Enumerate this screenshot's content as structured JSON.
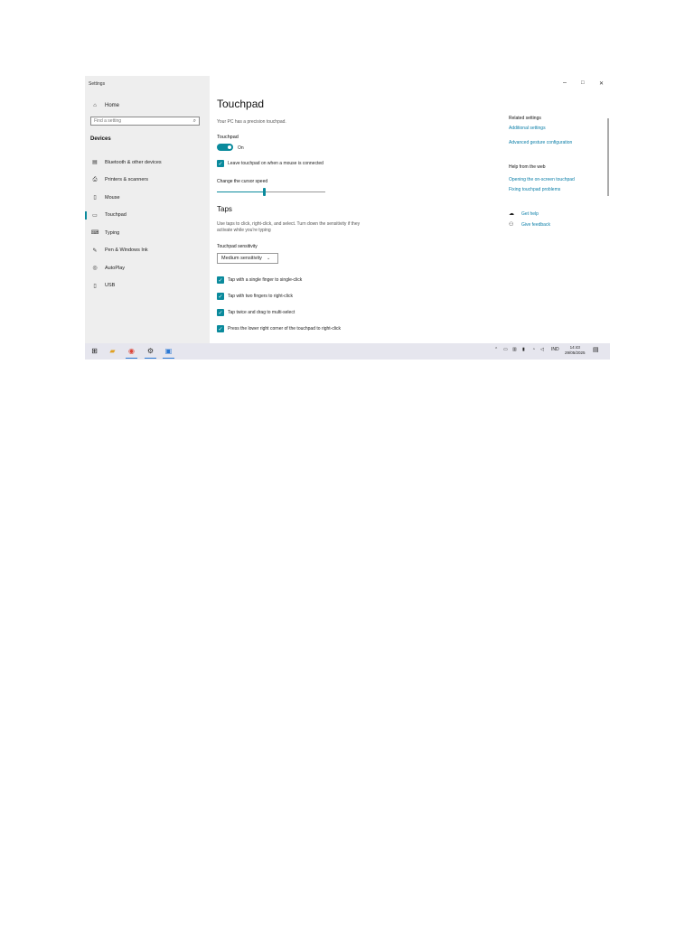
{
  "window": {
    "title": "Settings",
    "minimize": "–",
    "maximize": "□",
    "close": "✕"
  },
  "sidebar": {
    "home": "Home",
    "search_placeholder": "Find a setting",
    "section": "Devices",
    "items": [
      {
        "label": "Bluetooth & other devices",
        "icon": "bluetooth-devices-icon",
        "active": false
      },
      {
        "label": "Printers & scanners",
        "icon": "printer-icon",
        "active": false
      },
      {
        "label": "Mouse",
        "icon": "mouse-icon",
        "active": false
      },
      {
        "label": "Touchpad",
        "icon": "touchpad-icon",
        "active": true
      },
      {
        "label": "Typing",
        "icon": "keyboard-icon",
        "active": false
      },
      {
        "label": "Pen & Windows Ink",
        "icon": "pen-icon",
        "active": false
      },
      {
        "label": "AutoPlay",
        "icon": "autoplay-icon",
        "active": false
      },
      {
        "label": "USB",
        "icon": "usb-icon",
        "active": false
      }
    ]
  },
  "main": {
    "title": "Touchpad",
    "precision_note": "Your PC has a precision touchpad.",
    "touchpad_label": "Touchpad",
    "toggle_state": "On",
    "leave_on_label": "Leave touchpad on when a mouse is connected",
    "cursor_speed_label": "Change the cursor speed",
    "cursor_speed_value": 0.44,
    "taps_title": "Taps",
    "taps_desc_1": "Use taps to click, right-click, and select. Turn down the sensitivity if they",
    "taps_desc_2": "activate while you're typing",
    "sensitivity_label": "Touchpad sensitivity",
    "sensitivity_value": "Medium sensitivity",
    "tap_options": [
      "Tap with a single finger to single-click",
      "Tap with two fingers to right-click",
      "Tap twice and drag to multi-select",
      "Press the lower right corner of the touchpad to right-click"
    ]
  },
  "related": {
    "heading": "Related settings",
    "links": [
      "Additional settings",
      "Advanced gesture configuration"
    ],
    "help_heading": "Help from the web",
    "help_links": [
      "Opening the on-screen touchpad",
      "Fixing touchpad problems"
    ],
    "get_help": "Get help",
    "give_feedback": "Give feedback"
  },
  "taskbar": {
    "tray_lang": "IND",
    "time": "14:43",
    "date": "29/05/2025"
  },
  "colors": {
    "accent": "#0a8a9c",
    "link": "#0a7ea8",
    "sidebar_bg": "#eeeeee",
    "taskbar_bg": "#e6e6ee"
  }
}
